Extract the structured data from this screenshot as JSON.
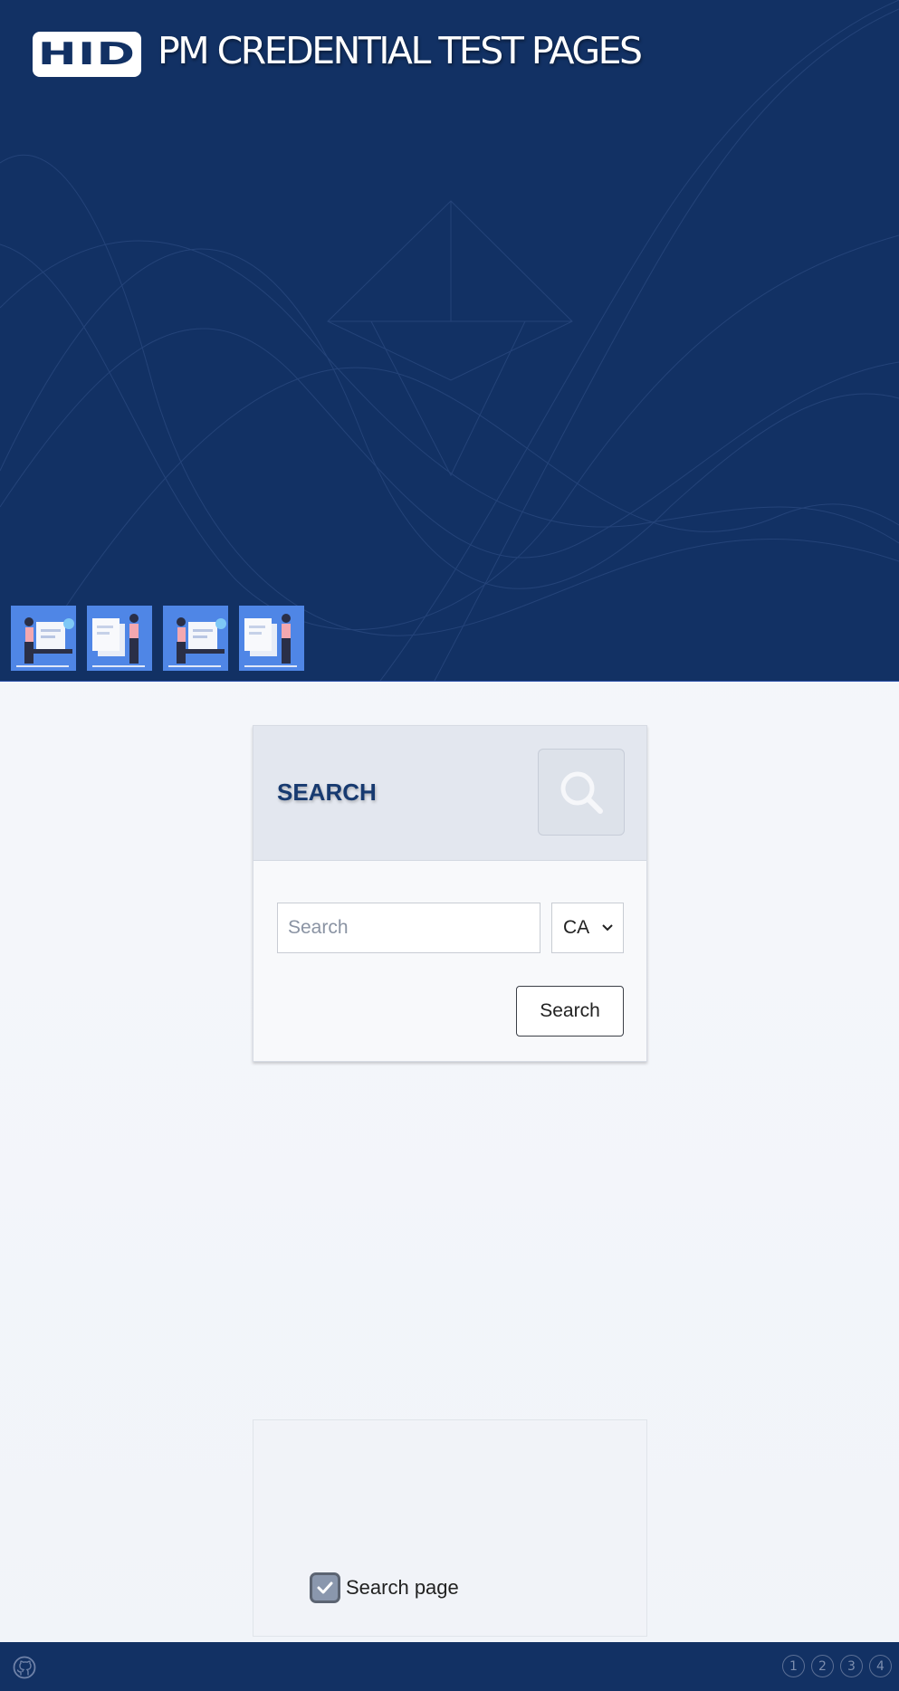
{
  "header": {
    "logo_text": "HID",
    "title": "PM CREDENTIAL TEST PAGES"
  },
  "thumbnails": [
    {
      "icon": "person-laptop-illustration"
    },
    {
      "icon": "person-documents-illustration"
    },
    {
      "icon": "person-laptop-illustration"
    },
    {
      "icon": "person-documents-illustration"
    }
  ],
  "search_card": {
    "title": "SEARCH",
    "input_placeholder": "Search",
    "input_value": "",
    "region_selected": "CA",
    "button_label": "Search"
  },
  "bottom_card": {
    "checkbox_label": "Search page",
    "checkbox_checked": true
  },
  "footer": {
    "pages": [
      "1",
      "2",
      "3",
      "4"
    ]
  },
  "colors": {
    "brand_navy": "#123164",
    "thumb_blue": "#4f86e6",
    "card_title": "#173a70"
  }
}
